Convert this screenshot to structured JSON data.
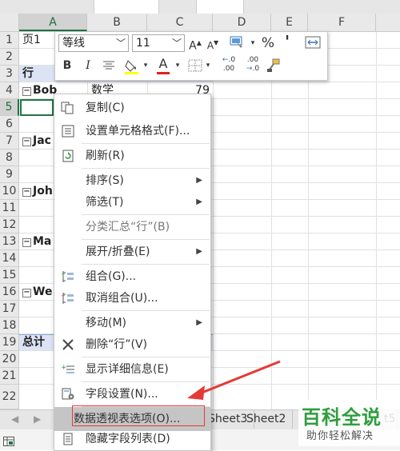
{
  "columns": [
    "A",
    "B",
    "C",
    "D",
    "E",
    "F"
  ],
  "rows": [
    "1",
    "2",
    "3",
    "4",
    "5",
    "6",
    "7",
    "8",
    "9",
    "10",
    "11",
    "12",
    "13",
    "14",
    "15",
    "16",
    "17",
    "18",
    "19",
    "20",
    "21",
    "22"
  ],
  "cells": {
    "a1": "页1",
    "a3": "行",
    "a4": "Bob",
    "a7": "Jac",
    "a10": "Joh",
    "a13": "Ma",
    "a16": "We",
    "a19": "总计",
    "b4": "数学",
    "c4": "79"
  },
  "mini_toolbar": {
    "font_name": "等线",
    "font_size": "11",
    "grow_font": "A",
    "shrink_font": "A",
    "percent": "%",
    "comma": "'",
    "bold": "B",
    "italic": "I",
    "font_color": "A",
    "inc_decimal": ".00",
    "dec_decimal": ".0"
  },
  "context_menu": [
    {
      "label": "复制(C)",
      "icon": "copy-icon",
      "submenu": false,
      "enabled": true
    },
    {
      "label": "设置单元格格式(F)...",
      "icon": "format-cells-icon",
      "submenu": false,
      "enabled": true
    },
    {
      "label": "刷新(R)",
      "icon": "refresh-icon",
      "submenu": false,
      "enabled": true
    },
    {
      "label": "排序(S)",
      "icon": "",
      "submenu": true,
      "enabled": true
    },
    {
      "label": "筛选(T)",
      "icon": "",
      "submenu": true,
      "enabled": true
    },
    {
      "label": "分类汇总“行”(B)",
      "icon": "",
      "submenu": false,
      "enabled": false
    },
    {
      "label": "展开/折叠(E)",
      "icon": "",
      "submenu": true,
      "enabled": true
    },
    {
      "label": "组合(G)...",
      "icon": "group-icon",
      "submenu": false,
      "enabled": true
    },
    {
      "label": "取消组合(U)...",
      "icon": "ungroup-icon",
      "submenu": false,
      "enabled": true
    },
    {
      "label": "移动(M)",
      "icon": "",
      "submenu": true,
      "enabled": true
    },
    {
      "label": "删除“行”(V)",
      "icon": "delete-x-icon",
      "submenu": false,
      "enabled": true
    },
    {
      "label": "显示详细信息(E)",
      "icon": "show-details-icon",
      "submenu": false,
      "enabled": true
    },
    {
      "label": "字段设置(N)...",
      "icon": "field-settings-icon",
      "submenu": false,
      "enabled": true
    },
    {
      "label": "数据透视表选项(O)...",
      "icon": "",
      "submenu": false,
      "enabled": true,
      "highlighted": true
    },
    {
      "label": "隐藏字段列表(D)",
      "icon": "field-list-icon",
      "submenu": false,
      "enabled": true
    }
  ],
  "sheet_tabs": [
    "Sheet3",
    "Sheet2",
    "t5"
  ],
  "watermark": {
    "title": "百科全说",
    "subtitle": "助你轻松解决"
  },
  "colors": {
    "accent_green": "#217346",
    "pivot_band": "#dbe3f4",
    "highlight_red": "#e53935",
    "arrow_red": "#e53935",
    "watermark_green": "#2e9e3e"
  }
}
